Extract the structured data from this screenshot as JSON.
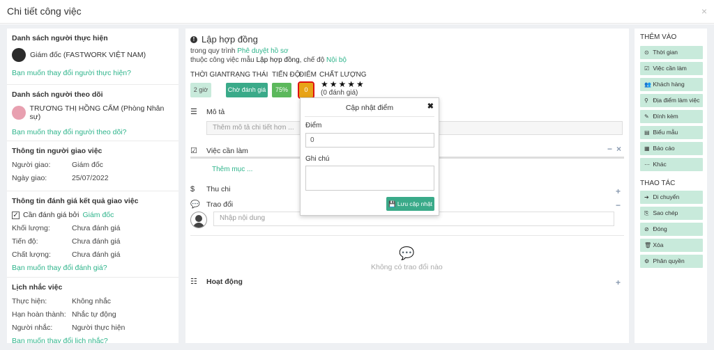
{
  "window": {
    "title": "Chi tiết công việc",
    "close_icon": "×"
  },
  "left": {
    "assignees": {
      "heading": "Danh sách người thực hiện",
      "person": "Giám đốc (FASTWORK VIỆT NAM)",
      "change_link": "Bạn muốn thay đổi người thực hiện?"
    },
    "followers": {
      "heading": "Danh sách người theo dõi",
      "person": "TRƯƠNG THỊ HỒNG CẨM (Phòng Nhân sự)",
      "change_link": "Bạn muốn thay đổi người theo dõi?"
    },
    "assigner": {
      "heading": "Thông tin người giao việc",
      "rows": [
        {
          "k": "Người giao:",
          "v": "Giám đốc"
        },
        {
          "k": "Ngày giao:",
          "v": "25/07/2022"
        }
      ]
    },
    "evaluation": {
      "heading": "Thông tin đánh giá kết quả giao việc",
      "check_label": "Cần đánh giá bởi",
      "check_by": "Giám đốc",
      "rows": [
        {
          "k": "Khối lượng:",
          "v": "Chưa đánh giá"
        },
        {
          "k": "Tiến độ:",
          "v": "Chưa đánh giá"
        },
        {
          "k": "Chất lượng:",
          "v": "Chưa đánh giá"
        }
      ],
      "change_link": "Bạn muốn thay đổi đánh giá?"
    },
    "reminders": {
      "heading": "Lịch nhắc việc",
      "rows": [
        {
          "k": "Thực hiện:",
          "v": "Không nhắc"
        },
        {
          "k": "Hạn hoàn thành:",
          "v": "Nhắc tự động"
        },
        {
          "k": "Người nhắc:",
          "v": "Người thực hiện"
        }
      ],
      "change_link": "Bạn muốn thay đổi lịch nhắc?"
    }
  },
  "center": {
    "title": "Lập hợp đồng",
    "process_prefix": "trong quy trình",
    "process_name": "Phê duyệt hồ sơ",
    "template_prefix": "thuộc công việc mẫu",
    "template_name": "Lập hợp đồng",
    "mode_prefix": ", chế độ",
    "mode_name": "Nội bộ",
    "meta_labels": {
      "time": "THỜI GIAN",
      "status": "TRẠNG THÁI",
      "progress": "TIẾN ĐỘ",
      "score": "ĐIỂM",
      "quality": "CHẤT LƯỢNG"
    },
    "time_value": "2 giờ",
    "status_value": "Chờ đánh giá",
    "progress_value": "75%",
    "score_value": "0",
    "stars": "★★★★★",
    "rating_count": "(0 đánh giá)",
    "description_label": "Mô tả",
    "description_placeholder": "Thêm mô tả chi tiết hơn ...",
    "checklist_label": "Việc cần làm",
    "checklist_add": "Thêm mục ...",
    "expense_label": "Thu chi",
    "discussion_label": "Trao đổi",
    "comment_placeholder": "Nhập nội dung",
    "empty_discussion": "Không có trao đổi nào",
    "activity_label": "Hoạt động",
    "plus": "+",
    "minus": "−",
    "close_x": "×"
  },
  "popup": {
    "title": "Cập nhật điểm",
    "close": "✖",
    "score_label": "Điểm",
    "score_value": "0",
    "note_label": "Ghi chú",
    "note_value": "",
    "save_label": "Lưu cập nhật"
  },
  "right": {
    "add_heading": "THÊM VÀO",
    "add_buttons": [
      {
        "icon": "⊙",
        "label": "Thời gian"
      },
      {
        "icon": "☑",
        "label": "Việc cần làm"
      },
      {
        "icon": "👥",
        "label": "Khách hàng"
      },
      {
        "icon": "⚲",
        "label": "Địa điểm làm việc"
      },
      {
        "icon": "✎",
        "label": "Đính kèm"
      },
      {
        "icon": "▤",
        "label": "Biểu mẫu"
      },
      {
        "icon": "▦",
        "label": "Báo cáo"
      },
      {
        "icon": "⋯",
        "label": "Khác"
      }
    ],
    "action_heading": "THAO TÁC",
    "action_buttons": [
      {
        "icon": "➔",
        "label": "Di chuyển"
      },
      {
        "icon": "⎘",
        "label": "Sao chép"
      },
      {
        "icon": "⊘",
        "label": "Đóng"
      },
      {
        "icon": "🗑",
        "label": "Xóa"
      },
      {
        "icon": "⚙",
        "label": "Phân quyền"
      }
    ]
  },
  "colors": {
    "accent_green": "#2eb48b",
    "button_bg": "#c8eadb",
    "score_chip": "#e8a317",
    "progress_chip": "#5cb85c"
  }
}
